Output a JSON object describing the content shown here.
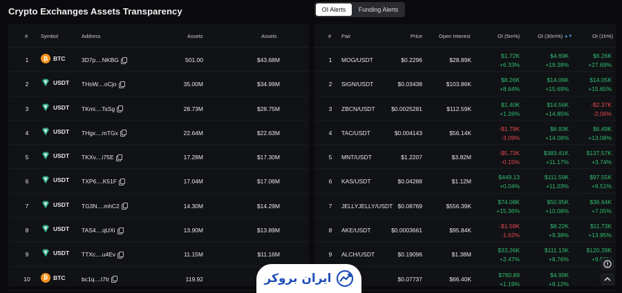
{
  "page": {
    "title": "Crypto Exchanges Assets Transparency"
  },
  "tabs": [
    {
      "label": "OI Alerts",
      "active": true
    },
    {
      "label": "Funding Alerts",
      "active": false
    }
  ],
  "colors": {
    "green": "#2fbf71",
    "red": "#e5484d",
    "btc": "#f2921b",
    "usdt": "#26a17b",
    "accent": "#4aa3ff"
  },
  "left_table": {
    "headers": {
      "num": "#",
      "symbol": "Symbol",
      "address": "Address",
      "assets1": "Assets",
      "assets2": "Assets"
    },
    "rows": [
      {
        "num": "1",
        "symbol": "BTC",
        "icon": "btc-icon",
        "address": "3D7p....NKBG",
        "assets1": "501.00",
        "assets2": "$43.68M"
      },
      {
        "num": "2",
        "symbol": "USDT",
        "icon": "usdt-icon",
        "address": "THoW....oCjo",
        "assets1": "35.00M",
        "assets2": "$34.99M"
      },
      {
        "num": "3",
        "symbol": "USDT",
        "icon": "usdt-icon",
        "address": "TKmi....TsSg",
        "assets1": "28.73M",
        "assets2": "$28.75M"
      },
      {
        "num": "4",
        "symbol": "USDT",
        "icon": "usdt-icon",
        "address": "THgx....mTGx",
        "assets1": "22.64M",
        "assets2": "$22.63M"
      },
      {
        "num": "5",
        "symbol": "USDT",
        "icon": "usdt-icon",
        "address": "TKXv....i75E",
        "assets1": "17.28M",
        "assets2": "$17.30M"
      },
      {
        "num": "6",
        "symbol": "USDT",
        "icon": "usdt-icon",
        "address": "TXP6....K51F",
        "assets1": "17.04M",
        "assets2": "$17.06M"
      },
      {
        "num": "7",
        "symbol": "USDT",
        "icon": "usdt-icon",
        "address": "TG3N....mhC2",
        "assets1": "14.30M",
        "assets2": "$14.29M"
      },
      {
        "num": "8",
        "symbol": "USDT",
        "icon": "usdt-icon",
        "address": "TAS4....qUXi",
        "assets1": "13.90M",
        "assets2": "$13.89M"
      },
      {
        "num": "9",
        "symbol": "USDT",
        "icon": "usdt-icon",
        "address": "TTXc....u4Ev",
        "assets1": "11.15M",
        "assets2": "$11.16M"
      },
      {
        "num": "10",
        "symbol": "BTC",
        "icon": "btc-icon",
        "address": "bc1q....t7tr",
        "assets1": "119.92",
        "assets2": ""
      }
    ]
  },
  "right_table": {
    "headers": {
      "num": "#",
      "pair": "Pair",
      "price": "Price",
      "oi": "Open Interest",
      "c1": "OI (5m%)",
      "c2": "OI (30m%)",
      "c3": "OI (1h%)"
    },
    "rows": [
      {
        "num": "1",
        "pair": "MOG/USDT",
        "price": "$0.2296",
        "oi": "$28.89K",
        "c1": [
          "$1.72K",
          "+6.33%",
          "g"
        ],
        "c2": [
          "$4.69K",
          "+19.38%",
          "g"
        ],
        "c3": [
          "$6.26K",
          "+27.69%",
          "g"
        ]
      },
      {
        "num": "2",
        "pair": "SIGN/USDT",
        "price": "$0.03438",
        "oi": "$103.86K",
        "c1": [
          "$8.26K",
          "+8.64%",
          "g"
        ],
        "c2": [
          "$14.09K",
          "+15.69%",
          "g"
        ],
        "c3": [
          "$14.05K",
          "+15.65%",
          "g"
        ]
      },
      {
        "num": "3",
        "pair": "ZBCN/USDT",
        "price": "$0.0025281",
        "oi": "$112.59K",
        "c1": [
          "$1.40K",
          "+1.26%",
          "g"
        ],
        "c2": [
          "$14.56K",
          "+14.85%",
          "g"
        ],
        "c3": [
          "-$2.37K",
          "-2.06%",
          "r"
        ]
      },
      {
        "num": "4",
        "pair": "TAC/USDT",
        "price": "$0.004143",
        "oi": "$56.14K",
        "c1": [
          "-$1.79K",
          "-3.09%",
          "r"
        ],
        "c2": [
          "$6.93K",
          "+14.08%",
          "g"
        ],
        "c3": [
          "$6.49K",
          "+13.08%",
          "g"
        ]
      },
      {
        "num": "5",
        "pair": "MNT/USDT",
        "price": "$1.2207",
        "oi": "$3.82M",
        "c1": [
          "-$5.73K",
          "-0.15%",
          "r"
        ],
        "c2": [
          "$383.41K",
          "+11.17%",
          "g"
        ],
        "c3": [
          "$137.57K",
          "+3.74%",
          "g"
        ]
      },
      {
        "num": "6",
        "pair": "KAS/USDT",
        "price": "$0.04288",
        "oi": "$1.12M",
        "c1": [
          "$449.13",
          "+0.04%",
          "g"
        ],
        "c2": [
          "$111.59K",
          "+11.03%",
          "g"
        ],
        "c3": [
          "$97.55K",
          "+9.51%",
          "g"
        ]
      },
      {
        "num": "7",
        "pair": "JELLYJELLY/USDT",
        "price": "$0.08769",
        "oi": "$556.39K",
        "c1": [
          "$74.08K",
          "+15.36%",
          "g"
        ],
        "c2": [
          "$50.95K",
          "+10.08%",
          "g"
        ],
        "c3": [
          "$36.64K",
          "+7.05%",
          "g"
        ]
      },
      {
        "num": "8",
        "pair": "AKE/USDT",
        "price": "$0.0003661",
        "oi": "$95.84K",
        "c1": [
          "-$1.58K",
          "-1.62%",
          "r"
        ],
        "c2": [
          "$8.22K",
          "+9.38%",
          "g"
        ],
        "c3": [
          "$11.73K",
          "+13.95%",
          "g"
        ]
      },
      {
        "num": "9",
        "pair": "ALCH/USDT",
        "price": "$0.19096",
        "oi": "$1.38M",
        "c1": [
          "$33.26K",
          "+2.47%",
          "g"
        ],
        "c2": [
          "$111.13K",
          "+8.76%",
          "g"
        ],
        "c3": [
          "$120.28K",
          "+9.55%",
          "g"
        ]
      },
      {
        "num": "10",
        "pair": "SDT",
        "price": "$0.07737",
        "oi": "$66.40K",
        "c1": [
          "$780.89",
          "+1.19%",
          "g"
        ],
        "c2": [
          "$4.99K",
          "+8.12%",
          "g"
        ],
        "c3": [
          "$3.",
          "",
          "g"
        ]
      }
    ]
  },
  "watermark": {
    "text": "ایران بروکر"
  }
}
